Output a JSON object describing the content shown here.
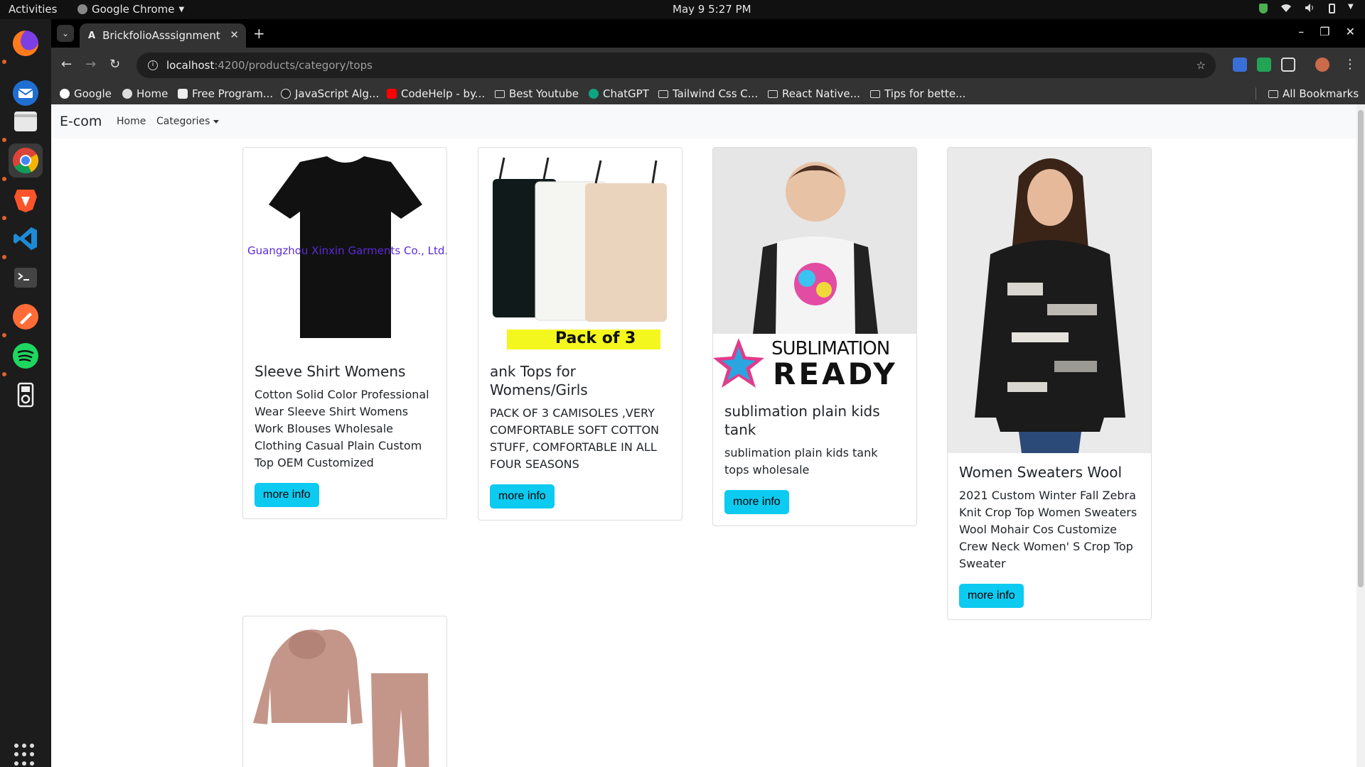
{
  "system": {
    "activities": "Activities",
    "app_name": "Google Chrome",
    "clock": "May 9  5:27 PM"
  },
  "browser": {
    "tab_title": "BrickfolioAsssignment",
    "url_host": "localhost",
    "url_path": ":4200/products/category/tops",
    "bookmarks": [
      {
        "label": "Google"
      },
      {
        "label": "Home"
      },
      {
        "label": "Free Program..."
      },
      {
        "label": "JavaScript Alg..."
      },
      {
        "label": "CodeHelp - by..."
      },
      {
        "label": "Best Youtube"
      },
      {
        "label": "ChatGPT"
      },
      {
        "label": "Tailwind Css C..."
      },
      {
        "label": "React Native..."
      },
      {
        "label": "Tips for bette..."
      }
    ],
    "all_bookmarks": "All Bookmarks"
  },
  "navbar": {
    "brand": "E-com",
    "home": "Home",
    "categories": "Categories"
  },
  "products": [
    {
      "title": "Sleeve Shirt Womens",
      "description": "Cotton Solid Color Professional Wear Sleeve Shirt Womens Work Blouses Wholesale Clothing Casual Plain Custom Top OEM Customized",
      "button": "more info",
      "image_text": "Guangzhou Xinxin Garments Co., Ltd."
    },
    {
      "title": "ank Tops for Womens/Girls",
      "description": "PACK OF 3 CAMISOLES ,VERY COMFORTABLE SOFT COTTON STUFF, COMFORTABLE IN ALL FOUR SEASONS",
      "button": "more info",
      "image_text": "Pack of 3"
    },
    {
      "title": "sublimation plain kids tank",
      "description": "sublimation plain kids tank tops wholesale",
      "button": "more info",
      "image_text_1": "SUBLIMATION",
      "image_text_2": "READY"
    },
    {
      "title": "Women Sweaters Wool",
      "description": "2021 Custom Winter Fall Zebra Knit Crop Top Women Sweaters Wool Mohair Cos Customize Crew Neck Women' S Crop Top Sweater",
      "button": "more info"
    }
  ],
  "colors": {
    "info_button": "#0dcaf0",
    "navbar_bg": "#f8f9fa"
  }
}
